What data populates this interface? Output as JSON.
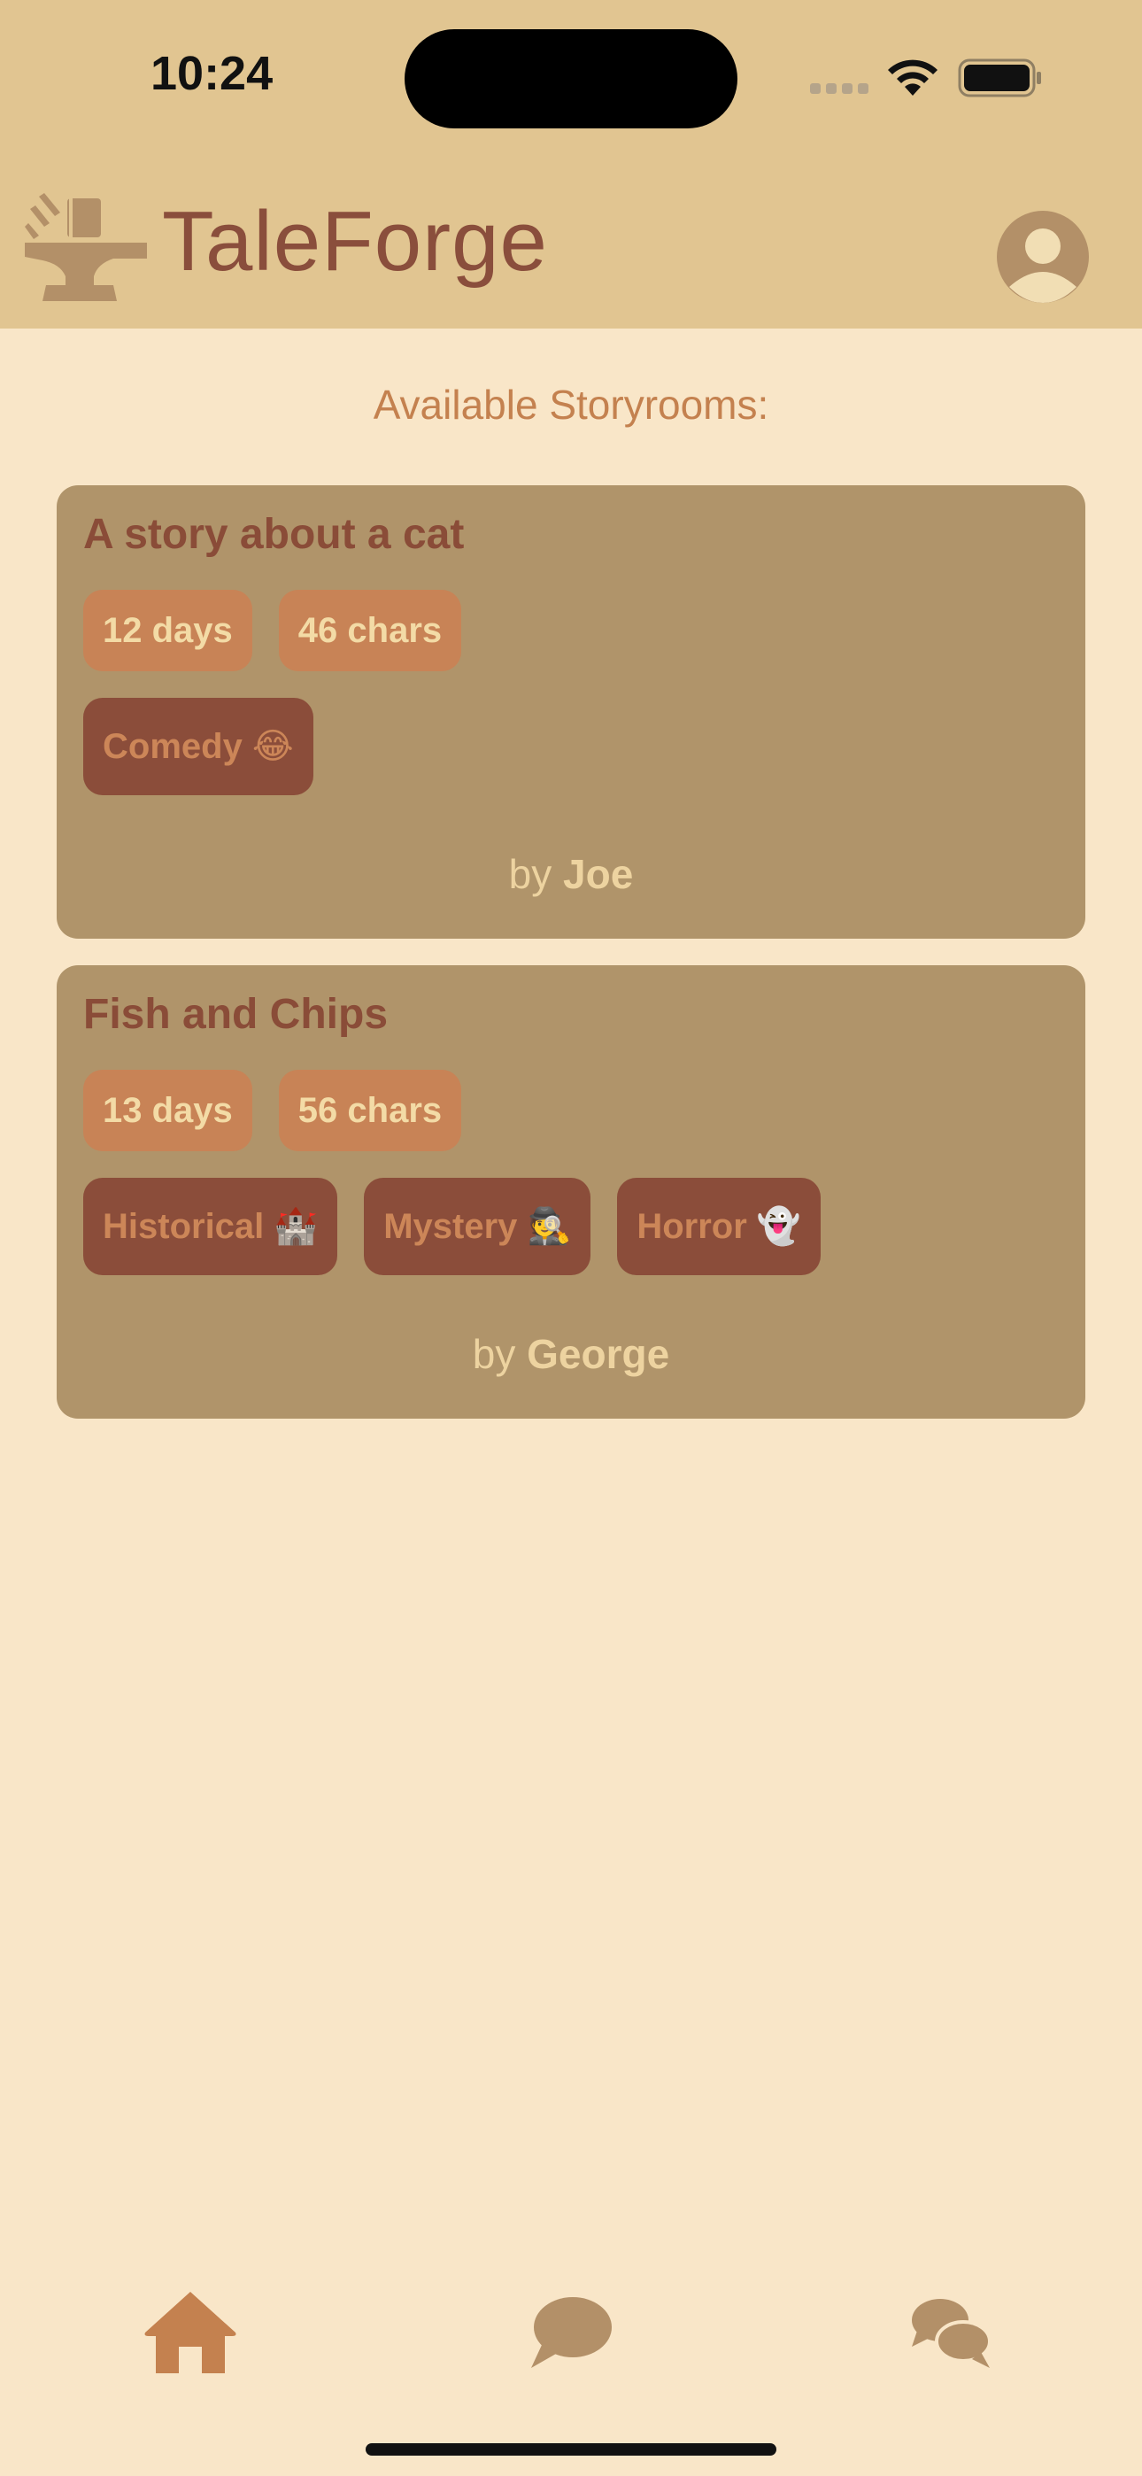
{
  "status_bar": {
    "time": "10:24"
  },
  "header": {
    "app_name": "TaleForge",
    "logo_icon": "anvil-icon",
    "profile_icon": "user-avatar-icon"
  },
  "main": {
    "section_title": "Available Storyrooms:"
  },
  "storyrooms": [
    {
      "title": "A story about a cat",
      "days": "12 days",
      "chars": "46 chars",
      "genres": [
        "Comedy 😂"
      ],
      "by_prefix": "by",
      "author": "Joe"
    },
    {
      "title": "Fish and Chips",
      "days": "13 days",
      "chars": "56 chars",
      "genres": [
        "Historical 🏰",
        "Mystery 🕵️",
        "Horror 👻"
      ],
      "by_prefix": "by",
      "author": "George"
    }
  ],
  "bottom_nav": {
    "items": [
      {
        "icon": "home-icon",
        "active": true
      },
      {
        "icon": "chat-bubble-icon",
        "active": false
      },
      {
        "icon": "chats-icon",
        "active": false
      }
    ]
  },
  "colors": {
    "header_bg": "#e1c591",
    "page_bg": "#f9e6c8",
    "card_bg": "#b0946a",
    "accent": "#c4814f",
    "brand_text": "#8a4e3c"
  }
}
